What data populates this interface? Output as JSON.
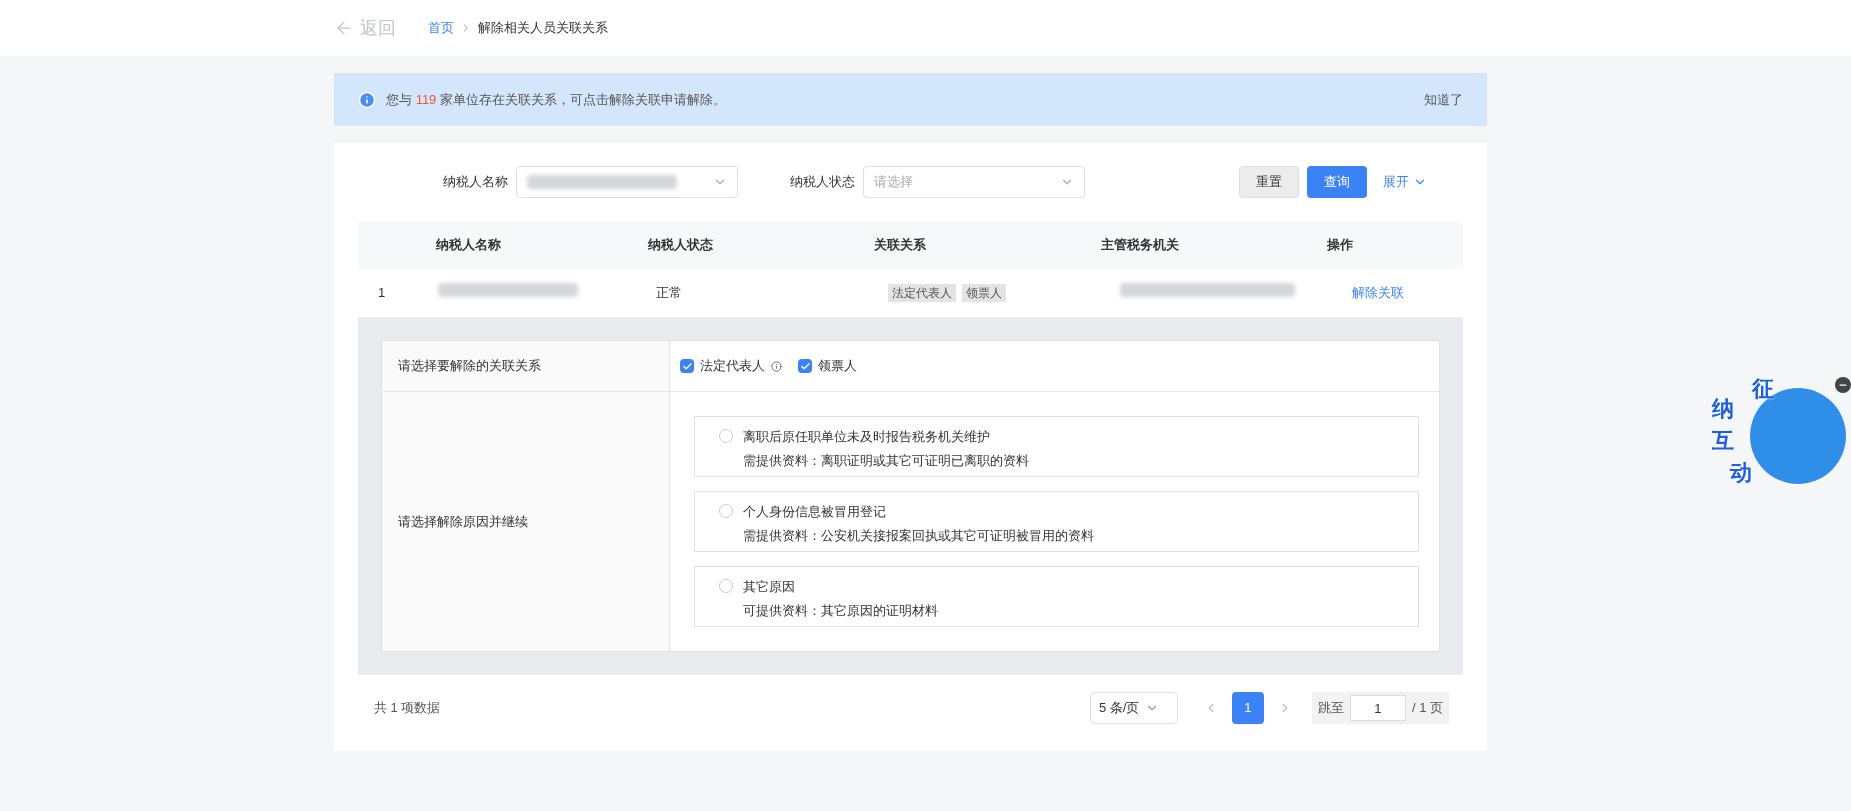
{
  "header": {
    "back": "返回",
    "breadcrumb": [
      {
        "label": "首页",
        "kind": "link"
      },
      {
        "label": "解除相关人员关联关系",
        "kind": "current"
      }
    ]
  },
  "alert": {
    "before": "您与",
    "count": "119",
    "after": "家单位存在关联关系，可点击解除关联申请解除。",
    "dismiss": "知道了"
  },
  "filters": [
    {
      "label": "纳税人名称",
      "redacted": true
    },
    {
      "label": "纳税人状态",
      "redacted": false,
      "placeholder": "请选择"
    }
  ],
  "buttons": {
    "reset": "重置",
    "query": "查询",
    "expand": "展开"
  },
  "table": {
    "columns": [
      "纳税人名称",
      "纳税人状态",
      "关联关系",
      "主管税务机关",
      "操作"
    ],
    "rows": [
      {
        "index": "1",
        "status": "正常",
        "tags": [
          "法定代表人",
          "领票人"
        ],
        "action": "解除关联",
        "expanded": true
      }
    ]
  },
  "detail": {
    "relation_label": "请选择要解除的关联关系",
    "relations": [
      {
        "label": "法定代表人",
        "checked": true,
        "info": true
      },
      {
        "label": "领票人",
        "checked": true,
        "info": false
      }
    ],
    "reason_label": "请选择解除原因并继续",
    "reasons": [
      {
        "title": "离职后原任职单位未及时报告税务机关维护",
        "note": "需提供资料：离职证明或其它可证明已离职的资料",
        "selected": false
      },
      {
        "title": "个人身份信息被冒用登记",
        "note": "需提供资料：公安机关接报案回执或其它可证明被冒用的资料",
        "selected": false
      },
      {
        "title": "其它原因",
        "note": "可提供资料：其它原因的证明材料",
        "selected": false
      }
    ]
  },
  "pagination": {
    "total": "共 1 项数据",
    "page_size": "5 条/页",
    "pages": [
      {
        "label": "1",
        "selected": true
      }
    ],
    "jump_label": "跳至",
    "jump_value": "1",
    "page_total": "/ 1 页"
  },
  "mascot": {
    "chars": [
      "征",
      "纳",
      "互",
      "动"
    ]
  }
}
